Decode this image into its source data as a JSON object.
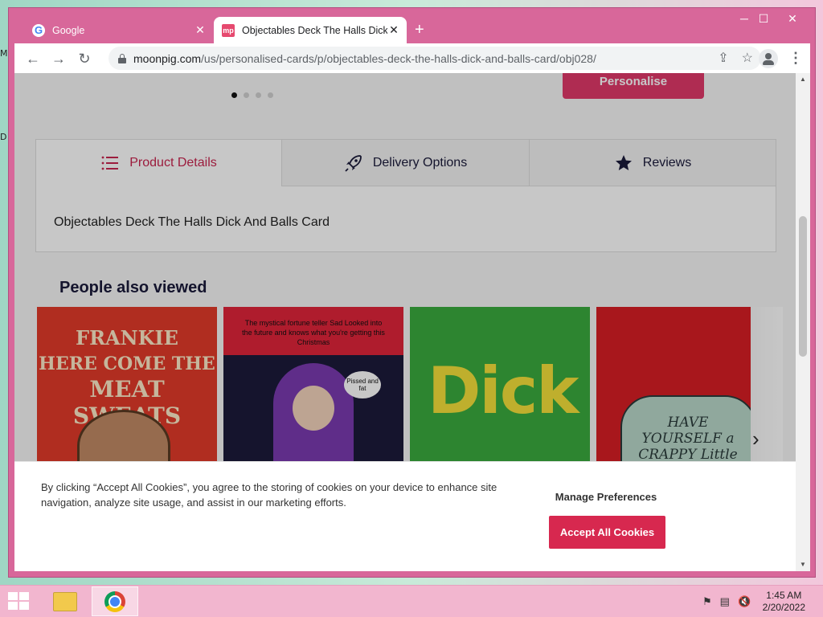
{
  "desktop": {
    "glyphs": [
      "M",
      "D"
    ]
  },
  "browser": {
    "tabs": [
      {
        "title": "Google",
        "favicon": "google-icon",
        "active": false
      },
      {
        "title": "Objectables Deck The Halls Dick",
        "favicon": "moonpig-icon",
        "active": true
      }
    ],
    "favicon_text": {
      "google": "G",
      "moonpig": "mp"
    },
    "window_controls": {
      "minimize": "─",
      "maximize": "☐",
      "close": "✕"
    },
    "new_tab": "+",
    "url": {
      "host": "moonpig.com",
      "path": "/us/personalised-cards/p/objectables-deck-the-halls-dick-and-balls-card/obj028/"
    }
  },
  "page": {
    "personalise_button": "Personalise",
    "carousel": {
      "count": 4,
      "active_index": 0
    },
    "detail_tabs": [
      {
        "label": "Product Details",
        "icon": "list-icon",
        "selected": true
      },
      {
        "label": "Delivery Options",
        "icon": "rocket-icon",
        "selected": false
      },
      {
        "label": "Reviews",
        "icon": "star-icon",
        "selected": false
      }
    ],
    "product_description": "Objectables Deck The Halls Dick And Balls Card",
    "people_also_viewed": {
      "heading": "People also viewed",
      "cards": [
        {
          "lines": [
            "FRANKIE",
            "HERE COME THE",
            "MEAT SWEATS"
          ]
        },
        {
          "top_text": "The mystical fortune teller Sad Looked into the future and knows what you're getting this Christmas",
          "bubble": "Pissed and fat"
        },
        {
          "word": "Dick"
        },
        {
          "text": "HAVE YOURSELF a CRAPPY Little Christmas"
        }
      ]
    }
  },
  "cookie_banner": {
    "text": "By clicking “Accept All Cookies”, you agree to the storing of cookies on your device to enhance site navigation, analyze site usage, and assist in our marketing efforts.",
    "manage_label": "Manage Preferences",
    "accept_label": "Accept All Cookies"
  },
  "taskbar": {
    "apps": [
      "file-explorer-icon",
      "chrome-icon"
    ],
    "time": "1:45 AM",
    "date": "2/20/2022"
  },
  "colors": {
    "brand": "#e0396a",
    "accept": "#d7284f",
    "window_frame": "#d8679a"
  }
}
